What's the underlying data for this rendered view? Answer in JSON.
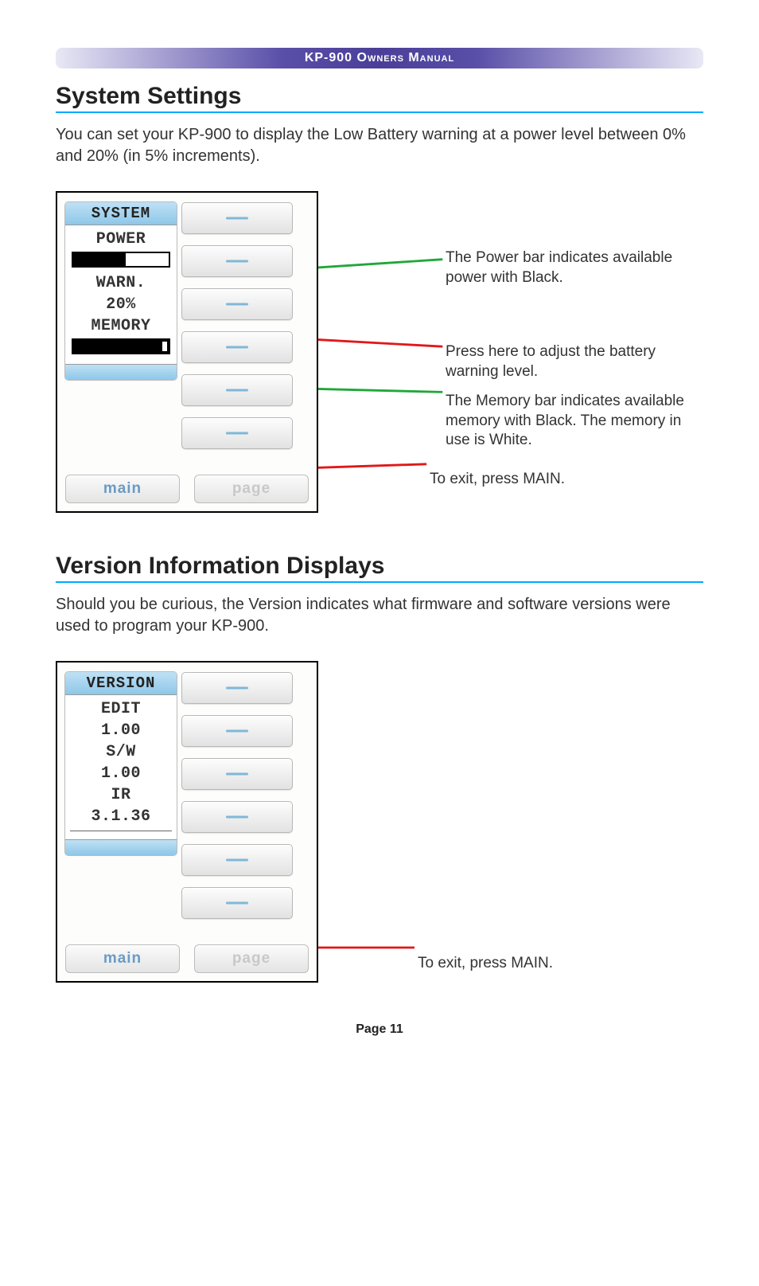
{
  "header": {
    "title_prefix": "KP-900 ",
    "title_small": "Owners Manual"
  },
  "section1": {
    "title": "System Settings",
    "intro": "You can set your KP-900 to display the Low Battery warning at a power level between 0% and 20% (in 5% increments).",
    "screen_header": "SYSTEM",
    "lines": {
      "power": "POWER",
      "warn": "WARN.",
      "pct": "20%",
      "memory": "MEMORY"
    },
    "power_bar_fill_pct": 55,
    "memory_bar_fill_pct": 88,
    "buttons": {
      "main": "main",
      "page": "page"
    },
    "callouts": {
      "c1": "The Power bar indicates available power with Black.",
      "c2": "Press here to adjust the battery warning level.",
      "c3": "The Memory bar indicates available memory with Black. The memory in use is White.",
      "c4": "To exit, press MAIN."
    }
  },
  "section2": {
    "title": "Version Information Displays",
    "intro": "Should you be curious, the Version indicates what firmware and software versions were used to program your KP-900.",
    "screen_header": "VERSION",
    "lines": {
      "edit": "EDIT",
      "edit_v": "1.00",
      "sw": "S/W",
      "sw_v": "1.00",
      "ir": "IR",
      "ir_v": "3.1.36"
    },
    "buttons": {
      "main": "main",
      "page": "page"
    },
    "callouts": {
      "c1": "To exit, press MAIN."
    }
  },
  "footer": {
    "page": "Page 11"
  },
  "colors": {
    "rule": "#00aaff",
    "arrow_green": "#1fa838",
    "arrow_red": "#e01818"
  }
}
